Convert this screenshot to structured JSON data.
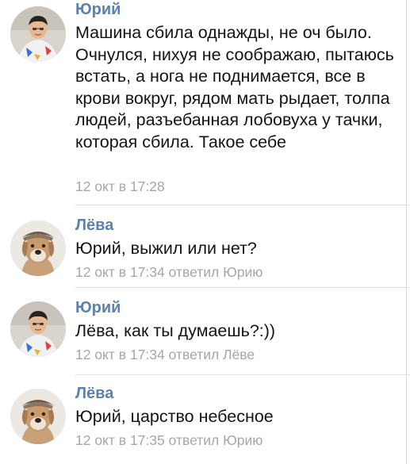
{
  "comments": [
    {
      "author": "Юрий",
      "text": "Машина сбила однажды, не оч было. Очнулся, нихуя не соображаю, пытаюсь встать, а нога не поднимается, все в крови вокруг, рядом мать рыдает, толпа людей, разъебанная лобовуха у тачки, которая сбила. Такое себе",
      "meta": "12 окт в 17:28"
    },
    {
      "author": "Лёва",
      "text": "Юрий, выжил или нет?",
      "meta": "12 окт в 17:34 ответил Юрию"
    },
    {
      "author": "Юрий",
      "text": "Лёва, как ты думаешь?:))",
      "meta": "12 окт в 17:34 ответил Лёве"
    },
    {
      "author": "Лёва",
      "text": "Юрий, царство небесное",
      "meta": "12 окт в 17:35 ответил Юрию"
    }
  ],
  "colors": {
    "author": "#5b82ad",
    "meta": "#a3a7ad",
    "text": "#141414",
    "divider": "#dfe2e6"
  },
  "icons": {
    "yuri_avatar": "person-photo-avatar",
    "leva_avatar": "dog-photo-avatar"
  }
}
